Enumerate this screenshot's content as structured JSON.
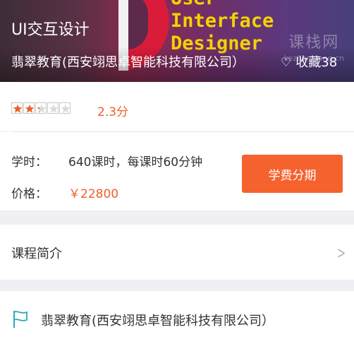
{
  "hero": {
    "poster_lines": [
      "User",
      "Interface",
      "Designer"
    ],
    "watermark": "课栈网",
    "watermark_url": "kezhanwang.cn",
    "course_title": "UI交互设计",
    "institution": "翡翠教育(西安翊思卓智能科技有限公司）",
    "favorite_label": "收藏38"
  },
  "rating": {
    "stars_total": 5,
    "stars_filled": 2.3,
    "score_text": "2.3分",
    "star_color": "#f05f2a"
  },
  "details": {
    "hours_label": "学时：",
    "hours_value": "640课时，每课时60分钟",
    "price_label": "价格：",
    "price_value": "￥22800",
    "installment_button": "学费分期"
  },
  "intro": {
    "label": "课程简介"
  },
  "institution_row": {
    "label": "翡翠教育(西安翊思卓智能科技有限公司）"
  },
  "colors": {
    "accent": "#f5622e",
    "price": "#f05f2a",
    "icon_teal": "#2aa8b8"
  },
  "icons": {
    "favorite": "heart-outline-icon",
    "intro_arrow": "chevron-right-icon",
    "institution": "flag-icon"
  }
}
